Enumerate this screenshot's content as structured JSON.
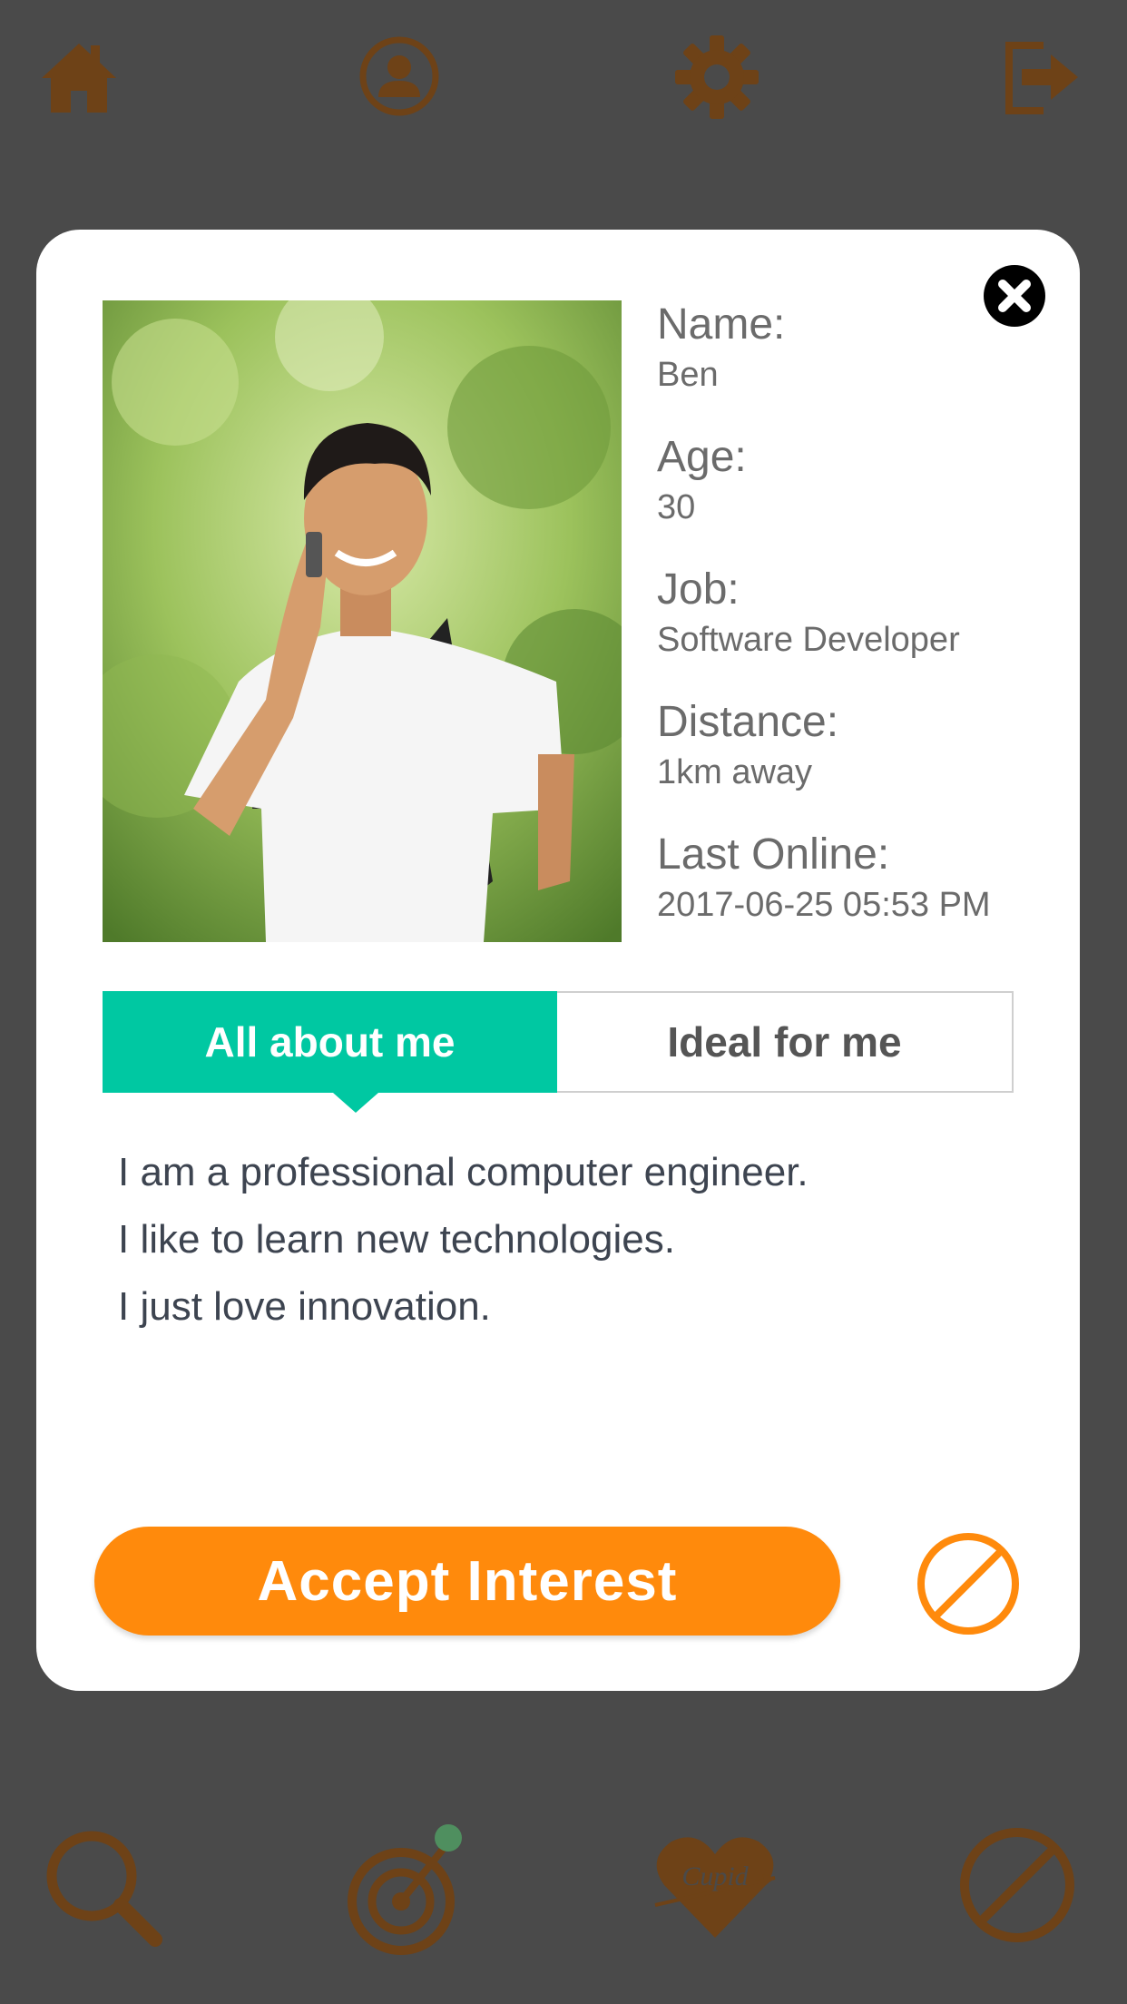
{
  "colors": {
    "background": "#4a4a4a",
    "nav_icon": "#6e4217",
    "accent_teal": "#00c8a2",
    "accent_orange": "#ff8a0c",
    "notification_dot": "#4f8f5f"
  },
  "top_nav": {
    "icons": [
      "home-icon",
      "profile-icon",
      "gear-icon",
      "logout-icon"
    ]
  },
  "bottom_nav": {
    "icons": [
      "search-icon",
      "target-icon",
      "heart-icon",
      "block-icon"
    ],
    "heart_text": "Cupid"
  },
  "modal": {
    "close_icon": "close-icon",
    "photo_icon": "profile-photo",
    "profile": {
      "name_label": "Name:",
      "name_value": "Ben",
      "age_label": "Age:",
      "age_value": "30",
      "job_label": "Job:",
      "job_value": "Software Developer",
      "distance_label": "Distance:",
      "distance_value": "1km away",
      "last_online_label": "Last Online:",
      "last_online_value": "2017-06-25 05:53 PM"
    },
    "tabs": [
      {
        "label": "All about me",
        "active": true
      },
      {
        "label": "Ideal for me",
        "active": false
      }
    ],
    "about_lines": [
      "I am a professional computer engineer.",
      "I like to learn new technologies.",
      "I just love innovation."
    ],
    "accept_label": "Accept Interest",
    "block_icon": "block-icon"
  }
}
